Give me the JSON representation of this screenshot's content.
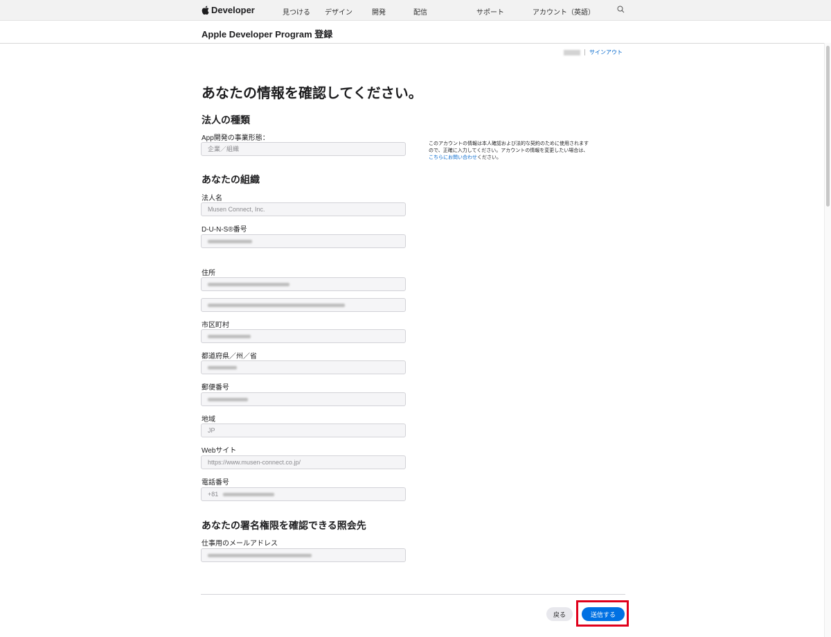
{
  "nav": {
    "brand": "Developer",
    "items": [
      "見つける",
      "デザイン",
      "開発",
      "配信",
      "サポート",
      "アカウント（英語）"
    ]
  },
  "program": {
    "title": "Apple Developer Program 登録"
  },
  "account": {
    "signout": "サインアウト"
  },
  "page": {
    "heading": "あなたの情報を確認してください。"
  },
  "entity": {
    "heading": "法人の種類",
    "type_label": "App開発の事業形態：",
    "type_value": "企業／組織"
  },
  "note": {
    "text_before": "このアカウントの情報は本人確認および法的な契約のために使用されますので、正確に入力してください。アカウントの情報を変更したい場合は、",
    "link": "こちらにお問い合わせ",
    "text_after": "ください。"
  },
  "org": {
    "heading": "あなたの組織",
    "name_label": "法人名",
    "name_value": "Musen Connect, Inc.",
    "duns_label": "D-U-N-S®番号",
    "address_label": "住所",
    "city_label": "市区町村",
    "state_label": "都道府県／州／省",
    "postal_label": "郵便番号",
    "country_label": "地域",
    "country_value": "JP",
    "website_label": "Webサイト",
    "website_value": "https://www.musen-connect.co.jp/",
    "phone_label": "電話番号",
    "phone_prefix": "+81"
  },
  "contact": {
    "heading": "あなたの署名権限を確認できる照会先",
    "email_label": "仕事用のメールアドレス"
  },
  "buttons": {
    "back": "戻る",
    "submit": "送信する"
  },
  "colors": {
    "accent": "#0071e3",
    "link": "#0066cc",
    "highlight": "#e0001b"
  }
}
